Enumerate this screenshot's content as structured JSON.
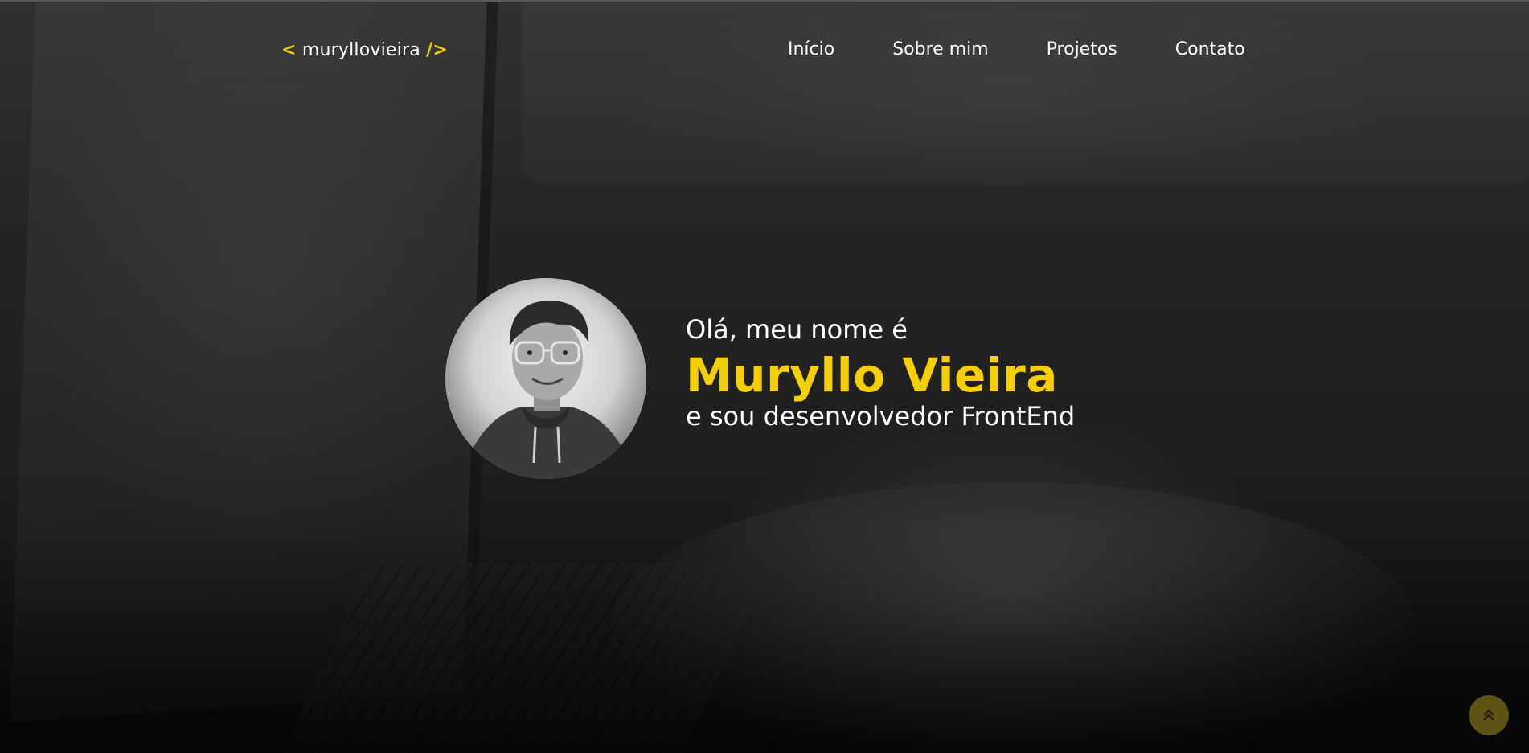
{
  "header": {
    "logo": {
      "open_bracket": "<",
      "text": "muryllovieira",
      "close_bracket": "/>"
    },
    "nav": [
      {
        "label": "Início"
      },
      {
        "label": "Sobre mim"
      },
      {
        "label": "Projetos"
      },
      {
        "label": "Contato"
      }
    ]
  },
  "intro": {
    "greeting": "Olá, meu nome é",
    "name": "Muryllo Vieira",
    "role": "e sou desenvolvedor FrontEnd"
  },
  "controls": {
    "scroll_top_icon": "double-chevron-up-icon"
  },
  "colors": {
    "accent": "#f5d000",
    "text": "#ffffff",
    "scroll_button": "#5e5215"
  }
}
